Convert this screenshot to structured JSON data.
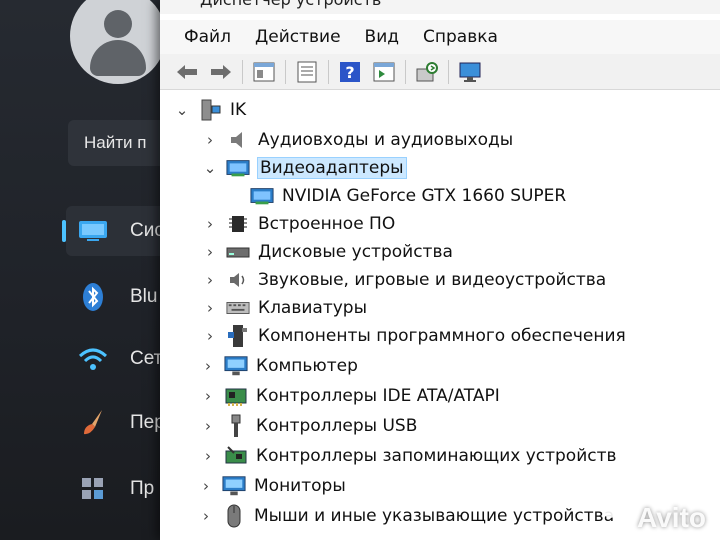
{
  "settings": {
    "search_text": "Найти п",
    "nav": [
      {
        "label": "Сис",
        "icon": "monitor-icon",
        "active": true
      },
      {
        "label": "Blu",
        "icon": "bluetooth-icon"
      },
      {
        "label": "Сет",
        "icon": "wifi-icon"
      },
      {
        "label": "Пер",
        "icon": "brush-icon"
      },
      {
        "label": "Пр",
        "icon": "apps-icon"
      }
    ]
  },
  "devmgr": {
    "title": "Диспетчер устройств",
    "menu": [
      "Файл",
      "Действие",
      "Вид",
      "Справка"
    ],
    "tree": {
      "root": "IK",
      "items": [
        {
          "label": "Аудиовходы и аудиовыходы",
          "icon": "speaker-icon",
          "expanded": false
        },
        {
          "label": "Видеоадаптеры",
          "icon": "display-adapter-icon",
          "expanded": true
        },
        {
          "label": "NVIDIA GeForce GTX 1660 SUPER",
          "icon": "display-adapter-icon",
          "child": true
        },
        {
          "label": "Встроенное ПО",
          "icon": "firmware-chip-icon",
          "expanded": false
        },
        {
          "label": "Дисковые устройства",
          "icon": "disk-drive-icon",
          "expanded": false
        },
        {
          "label": "Звуковые, игровые и видеоустройства",
          "icon": "sound-device-icon",
          "expanded": false
        },
        {
          "label": "Клавиатуры",
          "icon": "keyboard-icon",
          "expanded": false
        },
        {
          "label": "Компоненты программного обеспечения",
          "icon": "software-component-icon",
          "expanded": false
        },
        {
          "label": "Компьютер",
          "icon": "computer-icon",
          "expanded": false
        },
        {
          "label": "Контроллеры IDE ATA/ATAPI",
          "icon": "ide-controller-icon",
          "expanded": false
        },
        {
          "label": "Контроллеры USB",
          "icon": "usb-icon",
          "expanded": false
        },
        {
          "label": "Контроллеры запоминающих устройств",
          "icon": "storage-controller-icon",
          "expanded": false
        },
        {
          "label": "Мониторы",
          "icon": "monitor-icon",
          "expanded": false
        },
        {
          "label": "Мыши и иные указывающие устройства",
          "icon": "mouse-icon",
          "expanded": false
        }
      ]
    }
  },
  "watermark": "Avito",
  "colors": {
    "accent": "#4cc2ff",
    "selection": "#cce8ff",
    "dark_bg": "#1f2228"
  }
}
